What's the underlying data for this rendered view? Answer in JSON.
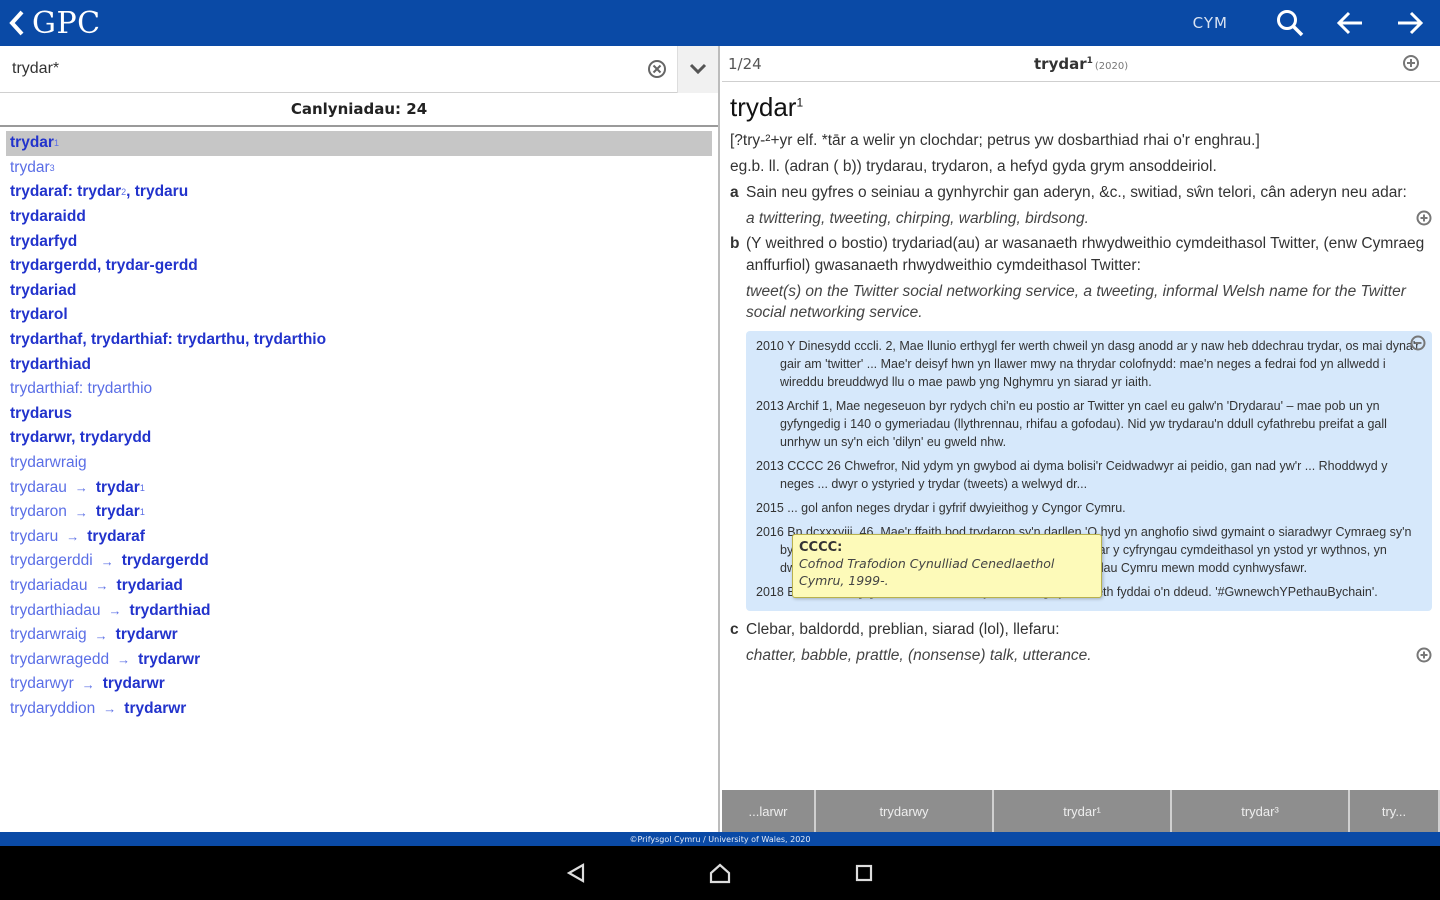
{
  "app": {
    "title": "GPC"
  },
  "topbar": {
    "lang_label": "CYM"
  },
  "search": {
    "value": "trydar*"
  },
  "results": {
    "header": "Canlyniadau: 24",
    "items": [
      {
        "parts": [
          {
            "t": "trydar",
            "c": "bold"
          },
          {
            "sup": "1"
          }
        ],
        "selected": true
      },
      {
        "parts": [
          {
            "t": "trydar",
            "c": "light"
          },
          {
            "sup": "3"
          }
        ]
      },
      {
        "parts": [
          {
            "t": "trydaraf: trydar",
            "c": "bold"
          },
          {
            "sup": "2"
          },
          {
            "t": ", trydaru",
            "c": "bold"
          }
        ]
      },
      {
        "parts": [
          {
            "t": "trydaraidd",
            "c": "bold"
          }
        ]
      },
      {
        "parts": [
          {
            "t": "trydarfyd",
            "c": "bold"
          }
        ]
      },
      {
        "parts": [
          {
            "t": "trydargerdd, trydar-gerdd",
            "c": "bold"
          }
        ]
      },
      {
        "parts": [
          {
            "t": "trydariad",
            "c": "bold"
          }
        ]
      },
      {
        "parts": [
          {
            "t": "trydarol",
            "c": "bold"
          }
        ]
      },
      {
        "parts": [
          {
            "t": "trydarthaf, trydarthiaf: trydarthu, trydarthio",
            "c": "bold"
          }
        ]
      },
      {
        "parts": [
          {
            "t": "trydarthiad",
            "c": "bold"
          }
        ]
      },
      {
        "parts": [
          {
            "t": "trydarthiaf: trydarthio",
            "c": "light"
          }
        ]
      },
      {
        "parts": [
          {
            "t": "trydarus",
            "c": "bold"
          }
        ]
      },
      {
        "parts": [
          {
            "t": "trydarwr, trydarydd",
            "c": "bold"
          }
        ]
      },
      {
        "parts": [
          {
            "t": "trydarwraig",
            "c": "light"
          }
        ]
      },
      {
        "parts": [
          {
            "t": "trydarau",
            "c": "light"
          },
          {
            "arrow": "→"
          },
          {
            "t": "trydar",
            "c": "bold"
          },
          {
            "sup": "1"
          }
        ]
      },
      {
        "parts": [
          {
            "t": "trydaron",
            "c": "light"
          },
          {
            "arrow": "→"
          },
          {
            "t": "trydar",
            "c": "bold"
          },
          {
            "sup": "1"
          }
        ]
      },
      {
        "parts": [
          {
            "t": "trydaru",
            "c": "light"
          },
          {
            "arrow": "→"
          },
          {
            "t": "trydaraf",
            "c": "bold"
          }
        ]
      },
      {
        "parts": [
          {
            "t": "trydargerddi",
            "c": "light"
          },
          {
            "arrow": "→"
          },
          {
            "t": "trydargerdd",
            "c": "bold"
          }
        ]
      },
      {
        "parts": [
          {
            "t": "trydariadau",
            "c": "light"
          },
          {
            "arrow": "→"
          },
          {
            "t": "trydariad",
            "c": "bold"
          }
        ]
      },
      {
        "parts": [
          {
            "t": "trydarthiadau",
            "c": "light"
          },
          {
            "arrow": "→"
          },
          {
            "t": "trydarthiad",
            "c": "bold"
          }
        ]
      },
      {
        "parts": [
          {
            "t": "trydarwraig",
            "c": "light"
          },
          {
            "arrow": "→"
          },
          {
            "t": "trydarwr",
            "c": "bold"
          }
        ]
      },
      {
        "parts": [
          {
            "t": "trydarwragedd",
            "c": "light"
          },
          {
            "arrow": "→"
          },
          {
            "t": "trydarwr",
            "c": "bold"
          }
        ]
      },
      {
        "parts": [
          {
            "t": "trydarwyr",
            "c": "light"
          },
          {
            "arrow": "→"
          },
          {
            "t": "trydarwr",
            "c": "bold"
          }
        ]
      },
      {
        "parts": [
          {
            "t": "trydaryddion",
            "c": "light"
          },
          {
            "arrow": "→"
          },
          {
            "t": "trydarwr",
            "c": "bold"
          }
        ]
      }
    ]
  },
  "entry": {
    "counter": "1/24",
    "header_word": "trydar",
    "header_sup": "1",
    "header_year": "(2020)",
    "headword": "trydar",
    "headword_sup": "1",
    "etymology": "[?try-²+yr elf. *tār a welir yn clochdar; petrus yw dosbarthiad rhai o'r enghrau.]",
    "grammar": "eg.b. ll. (adran ( b)) trydarau, trydaron, a hefyd gyda grym ansoddeiriol.",
    "sense_a_label": "a",
    "sense_a_text": "Sain neu gyfres o seiniau a gynhyrchir gan aderyn, &c., switiad, sŵn telori, cân aderyn neu adar:",
    "sense_a_gloss": "a twittering, tweeting, chirping, warbling, birdsong.",
    "sense_b_label": "b",
    "sense_b_text": "(Y weithred o bostio) trydariad(au) ar wasanaeth rhwydweithio cymdeithasol Twitter, (enw Cymraeg anffurfiol) gwasanaeth rhwydweithio cymdeithasol Twitter:",
    "sense_b_gloss": "tweet(s) on the Twitter social networking service, a tweeting, informal Welsh name for the Twitter social networking service.",
    "citations": [
      "2010 Y Dinesydd cccli. 2, Mae llunio erthygl fer werth chweil yn dasg anodd ar y naw heb ddechrau trydar, os mai dyna'r gair am 'twitter' ... Mae'r deisyf hwn yn llawer mwy na thrydar colofnydd: mae'n neges a fedrai fod yn allwedd i wireddu breuddwyd llu o mae pawb yng Nghymru yn siarad yr iaith.",
      "2013 Archif 1, Mae negeseuon byr rydych chi'n eu postio ar Twitter yn cael eu galw'n 'Drydarau' – mae pob un yn gyfyngedig i 140 o gymeriadau (llythrennau, rhifau a gofodau). Nid yw trydarau'n ddull cyfathrebu preifat a gall unrhyw un sy'n eich 'dilyn' eu gweld nhw.",
      "2013 CCCC 26 Chwefror, Nid ydym yn gwybod ai dyma bolisi'r Ceidwadwyr ai peidio, gan nad yw'r ... Rhoddwyd y neges ... dwyr o ystyried y trydar (tweets) a welwyd dr...",
      "2015 ... gol anfon neges drydar i gyfrif dwyieithog y Cyngor Cymru.",
      "2016 Bn dcxxxviii. 46, Mae'r ffaith bod trydaron sy'n darllen 'O hyd yn anghofio siwd gymaint o siaradwyr Cymraeg sy'n byw yn y Cymoedd' wedi adlewyrchu'r ymateb cyffredinol ar y cyfryngau cymdeithasol yn ystod yr wythnos, yn dweud y cyfan o ran diffyg S4C i adlewyrchu holl gymunedau Cymru mewn modd cynhwysfawr.",
      "2018 Bn dcliii. 49, [P]etai Dewi Sant ar Trydar dwi'n gwybod beth fyddai o'n ddeud. '#GwnewchYPethauBychain'."
    ],
    "sense_c_label": "c",
    "sense_c_text": "Clebar, baldordd, preblian, siarad (lol), llefaru:",
    "sense_c_gloss": "chatter, babble, prattle, (nonsense) talk, utterance."
  },
  "tooltip": {
    "title": "CCCC:",
    "body": "Cofnod Trafodion Cynulliad Cenedlaethol Cymru, 1999-."
  },
  "navtabs": [
    "...larwr",
    "trydarwy",
    "trydar¹",
    "trydar³",
    "try..."
  ],
  "footer": {
    "text": "©Prifysgol Cymru / University of Wales, 2020"
  },
  "colors": {
    "brand": "#0a4aa6",
    "link_bold": "#2233cc",
    "link_light": "#5a6ee6",
    "citation_bg": "#d6e8fb",
    "tooltip_bg": "#fdfab9"
  }
}
